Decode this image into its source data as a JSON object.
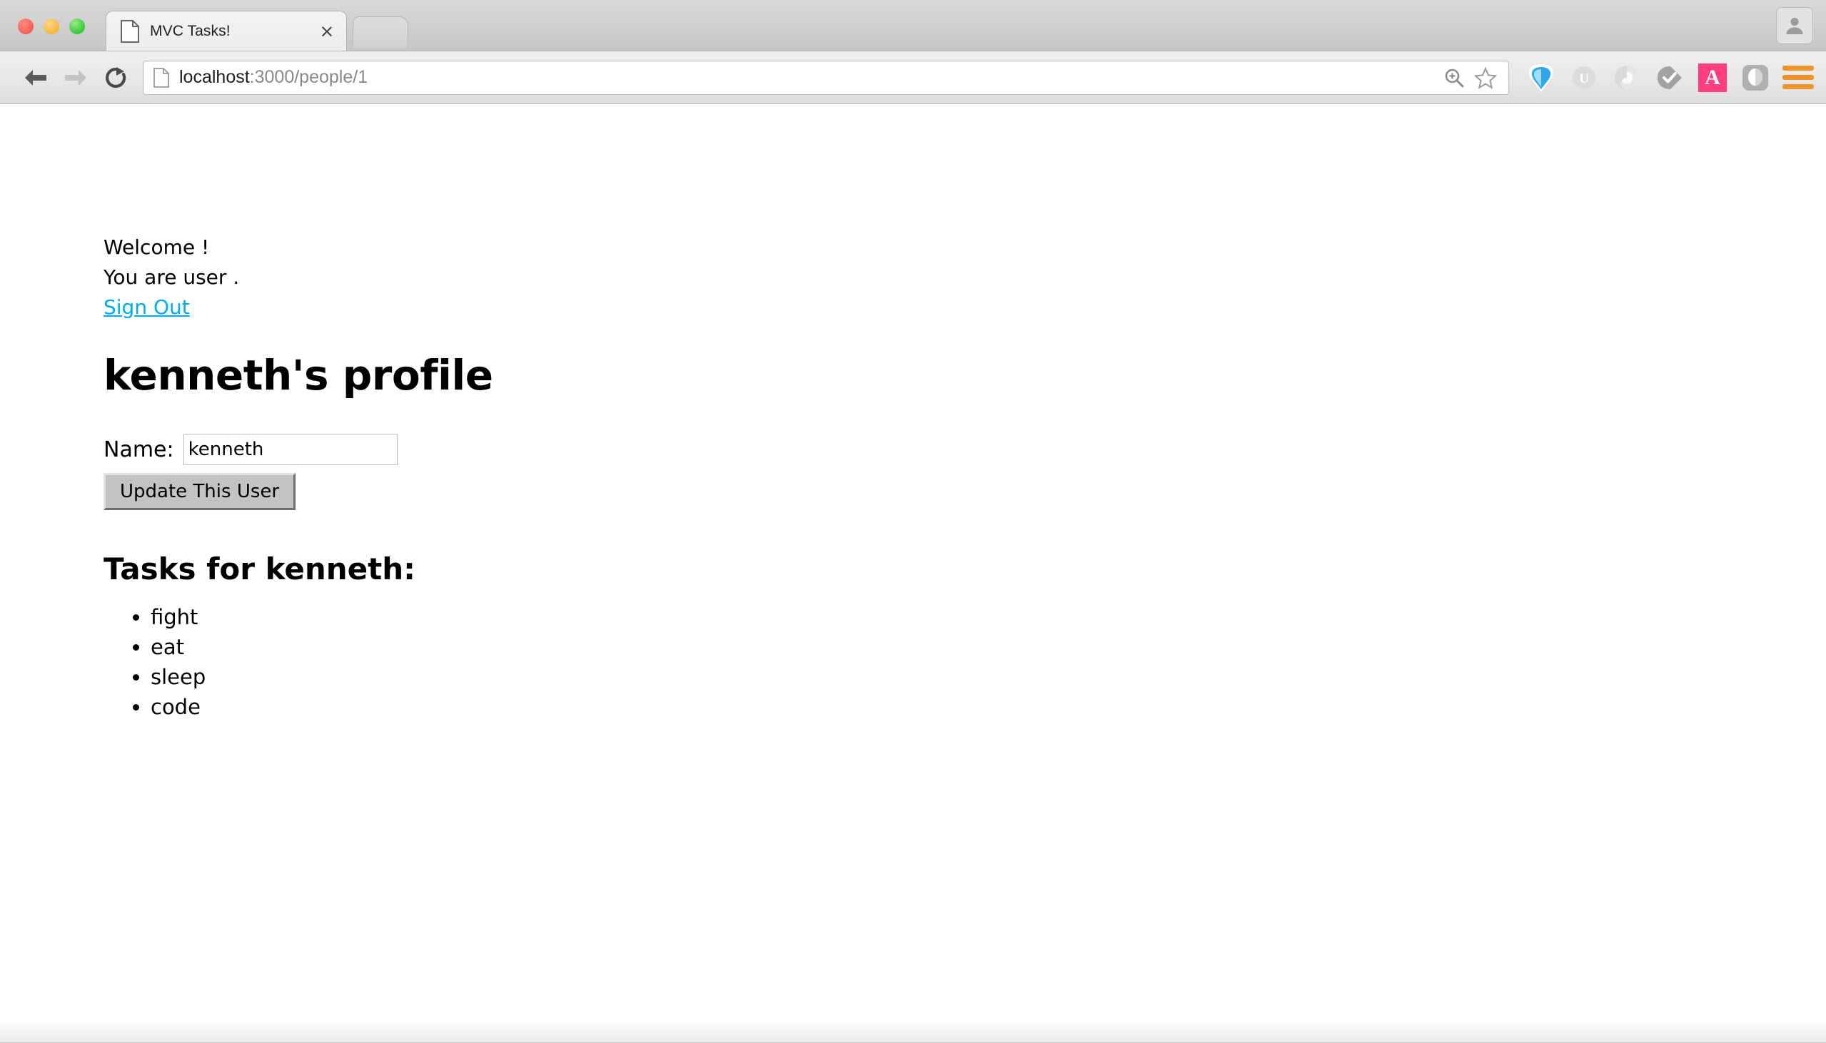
{
  "browser": {
    "traffic_lights": [
      "close",
      "minimize",
      "maximize"
    ],
    "tab": {
      "title": "MVC Tasks!",
      "favicon": "page-icon",
      "close_label": "×"
    },
    "new_tab_label": "",
    "toolbar": {
      "back_label": "",
      "forward_label": "",
      "reload_label": "",
      "url_main": "localhost",
      "url_rest": ":3000/people/1",
      "url_full": "localhost:3000/people/1",
      "page_favicon": "page-icon",
      "omnibox_actions": [
        "zoom-in-icon",
        "bookmark-star-icon"
      ],
      "extensions": [
        {
          "name": "gem-icon",
          "glyph": "◆",
          "color": "#2196f3"
        },
        {
          "name": "evernote-u-icon",
          "glyph": "U",
          "color": "#bdbdbd"
        },
        {
          "name": "ring-icon",
          "glyph": "○",
          "color": "#cccccc"
        },
        {
          "name": "checkmark-shield-icon",
          "glyph": "✔",
          "color": "#9e9e9e"
        },
        {
          "name": "letter-a-icon",
          "glyph": "A",
          "color": "#ff3d7f"
        },
        {
          "name": "oval-app-icon",
          "glyph": "●",
          "color": "#aaaaaa"
        },
        {
          "name": "hamburger-menu-icon",
          "glyph": "☰",
          "color": "#f0932b"
        }
      ]
    },
    "profile_avatar": "person-icon"
  },
  "page": {
    "welcome_text": "Welcome !",
    "user_text": "You are user .",
    "sign_out_label": "Sign Out",
    "sign_out_color": "#00AEF0",
    "profile_heading": "kenneth's profile",
    "form": {
      "name_label": "Name:",
      "name_value": "kenneth",
      "name_placeholder": "",
      "submit_label": "Update This User"
    },
    "tasks_heading": "Tasks for kenneth:",
    "tasks": [
      "fight",
      "eat",
      "sleep",
      "code"
    ]
  }
}
